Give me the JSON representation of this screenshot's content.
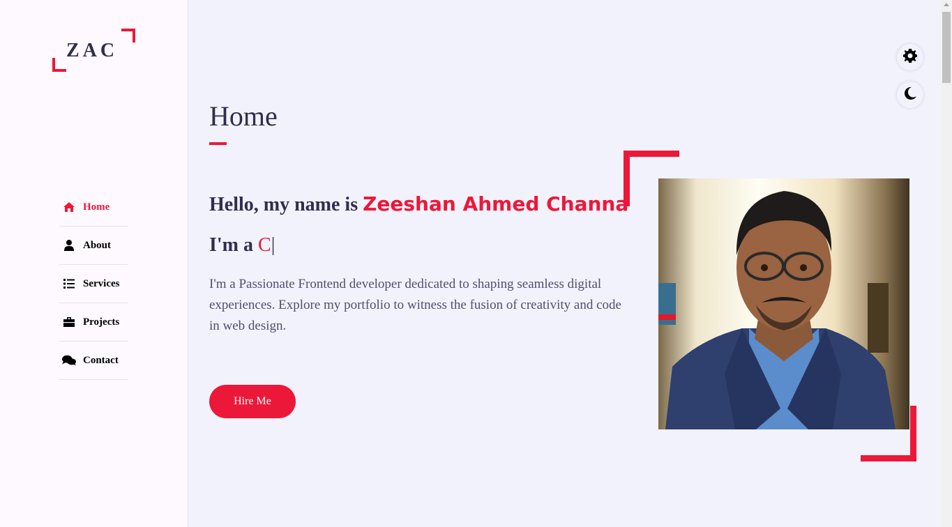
{
  "logo": {
    "text": "ZAC"
  },
  "nav": {
    "items": [
      {
        "label": "Home",
        "icon": "home-icon",
        "active": true
      },
      {
        "label": "About",
        "icon": "user-icon",
        "active": false
      },
      {
        "label": "Services",
        "icon": "list-icon",
        "active": false
      },
      {
        "label": "Projects",
        "icon": "briefcase-icon",
        "active": false
      },
      {
        "label": "Contact",
        "icon": "comments-icon",
        "active": false
      }
    ]
  },
  "main": {
    "title": "Home",
    "hello_prefix": "Hello, my name is ",
    "name": "Zeeshan Ahmed Channa",
    "im_a_prefix": "I'm a ",
    "typed_text": "C",
    "cursor": "|",
    "description": "I'm a Passionate Frontend developer dedicated to shaping seamless digital experiences. Explore my portfolio to witness the fusion of creativity and code in web design.",
    "hire_button": "Hire Me"
  },
  "colors": {
    "accent": "#ec1839",
    "background": "#f2f2fc",
    "text_dark": "#302e4d",
    "text_body": "#504e70"
  },
  "controls": {
    "settings_icon": "gear-icon",
    "theme_icon": "moon-icon"
  }
}
